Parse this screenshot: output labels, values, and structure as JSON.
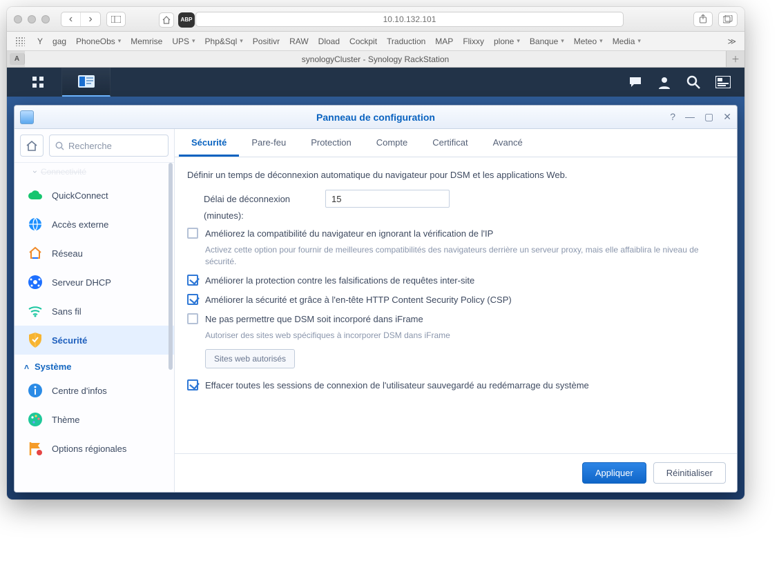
{
  "browser": {
    "url": "10.10.132.101",
    "back": "‹",
    "forward": "›",
    "sidebar": "☰",
    "share": "⇪",
    "tabs_btn": "⧉",
    "reader": "A",
    "bookmarks": [
      "Y",
      "gag",
      "PhoneObs",
      "Memrise",
      "UPS",
      "Php&Sql",
      "Positivr",
      "RAW",
      "Dload",
      "Cockpit",
      "Traduction",
      "MAP",
      "Flixxy",
      "plone",
      "Banque",
      "Meteo",
      "Media"
    ],
    "bookmarks_dd": [
      false,
      false,
      true,
      false,
      true,
      true,
      false,
      false,
      false,
      false,
      false,
      false,
      false,
      true,
      true,
      true,
      true
    ],
    "tab_title": "synologyCluster - Synology RackStation",
    "more": "≫"
  },
  "panel": {
    "title": "Panneau de configuration",
    "search_placeholder": "Recherche",
    "win": {
      "help": "?",
      "min": "—",
      "max": "▢",
      "close": "✕"
    }
  },
  "sidebar": {
    "partial_group": "Connectivité",
    "items": [
      {
        "key": "quickconnect",
        "label": "QuickConnect",
        "color": "#17c56f"
      },
      {
        "key": "external",
        "label": "Accès externe",
        "color": "#1e90ff"
      },
      {
        "key": "network",
        "label": "Réseau",
        "color": "#f08a2a"
      },
      {
        "key": "dhcp",
        "label": "Serveur DHCP",
        "color": "#1e70ff"
      },
      {
        "key": "wifi",
        "label": "Sans fil",
        "color": "#1ac6a0"
      },
      {
        "key": "security",
        "label": "Sécurité",
        "color": "#f7b431",
        "current": true
      }
    ],
    "group2": "Système",
    "items2": [
      {
        "key": "info",
        "label": "Centre d'infos",
        "color": "#2b8be6"
      },
      {
        "key": "theme",
        "label": "Thème",
        "color": "#1fc89a"
      },
      {
        "key": "regional",
        "label": "Options régionales",
        "color": "#f59b28"
      }
    ]
  },
  "tabs": [
    "Sécurité",
    "Pare-feu",
    "Protection",
    "Compte",
    "Certificat",
    "Avancé"
  ],
  "form": {
    "intro": "Définir un temps de déconnexion automatique du navigateur pour DSM et les applications Web.",
    "timeout_label": "Délai de déconnexion (minutes):",
    "timeout_label_line1": "Délai de déconnexion",
    "timeout_label_line2": "(minutes):",
    "timeout_value": "15",
    "ck1": "Améliorez la compatibilité du navigateur en ignorant la vérification de l'IP",
    "ck1_hint": "Activez cette option pour fournir de meilleures compatibilités des navigateurs derrière un serveur proxy, mais elle affaiblira le niveau de sécurité.",
    "ck2": "Améliorer la protection contre les falsifications de requêtes inter-site",
    "ck3": "Améliorer la sécurité et grâce à l'en-tête HTTP Content Security Policy (CSP)",
    "ck4": "Ne pas permettre que DSM soit incorporé dans iFrame",
    "ck4_hint": "Autoriser des sites web spécifiques à incorporer DSM dans iFrame",
    "allowed_sites_btn": "Sites web autorisés",
    "ck5": "Effacer toutes les sessions de connexion de l'utilisateur sauvegardé au redémarrage du système",
    "apply": "Appliquer",
    "reset": "Réinitialiser"
  },
  "colors": {
    "accent": "#0a63c0",
    "primary_btn": "#1672d4",
    "sidebar_sel": "#e5f0ff"
  }
}
